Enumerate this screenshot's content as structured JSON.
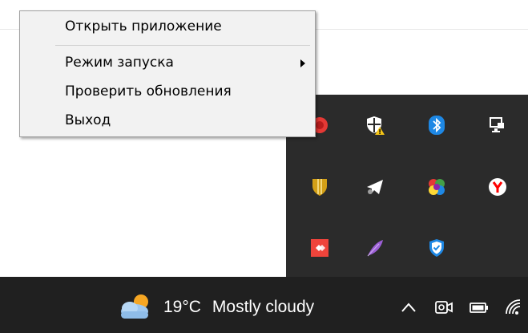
{
  "context_menu": {
    "items": [
      {
        "label": "Открыть приложение"
      },
      {
        "label": "Режим запуска",
        "has_submenu": true
      },
      {
        "label": "Проверить обновления"
      },
      {
        "label": "Выход"
      }
    ]
  },
  "tray_overflow": {
    "icons": [
      {
        "name": "red-circle-app-icon",
        "color": "#e53935"
      },
      {
        "name": "windows-security-warning-icon",
        "color": "#ffffff"
      },
      {
        "name": "bluetooth-icon",
        "color": "#1e88e5"
      },
      {
        "name": "network-monitor-icon",
        "color": "#ffffff"
      },
      {
        "name": "shield-gold-icon",
        "color": "#d4a017"
      },
      {
        "name": "telegram-icon",
        "color": "#ffffff"
      },
      {
        "name": "color-wheel-icon",
        "color": "#e53935"
      },
      {
        "name": "yandex-browser-icon",
        "color": "#ff0000"
      },
      {
        "name": "anydesk-icon",
        "color": "#ef443b"
      },
      {
        "name": "feather-icon",
        "color": "#9c5fd6"
      },
      {
        "name": "shield-check-icon",
        "color": "#1e88e5"
      }
    ]
  },
  "taskbar": {
    "weather": {
      "temperature": "19°C",
      "description": "Mostly cloudy"
    },
    "icons": [
      "chevron-up-icon",
      "meet-now-icon",
      "battery-icon",
      "wifi-icon"
    ]
  }
}
